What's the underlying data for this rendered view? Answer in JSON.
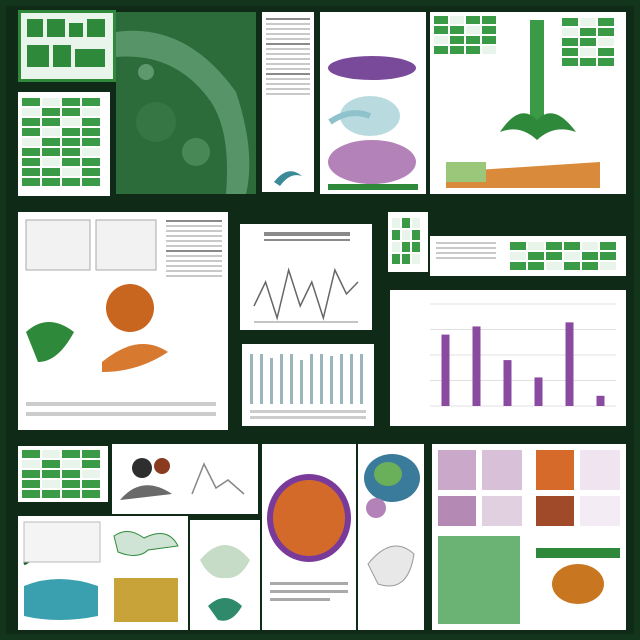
{
  "image": {
    "description_free": true
  },
  "palette": {
    "background": "#12351c",
    "panel": "#ffffff",
    "green": "#2e8a3a",
    "dark_green": "#1f5e2a",
    "orange": "#c8661f",
    "purple": "#8a4aa0",
    "teal": "#5a9aa6"
  },
  "icons": [
    "leaf-illustration",
    "tuber-illustration",
    "root-illustration",
    "mushroom-illustration"
  ],
  "chart_data": [
    {
      "type": "line",
      "title": "",
      "xlabel": "",
      "ylabel": "",
      "series": [
        {
          "values": [
            5,
            7,
            4,
            8,
            5,
            7,
            4,
            8,
            6,
            7
          ]
        }
      ]
    },
    {
      "type": "bar",
      "title": "",
      "xlabel": "",
      "ylabel": "",
      "ylim": [
        0,
        100
      ],
      "values": [
        70,
        78,
        45,
        28,
        82,
        10
      ]
    }
  ]
}
